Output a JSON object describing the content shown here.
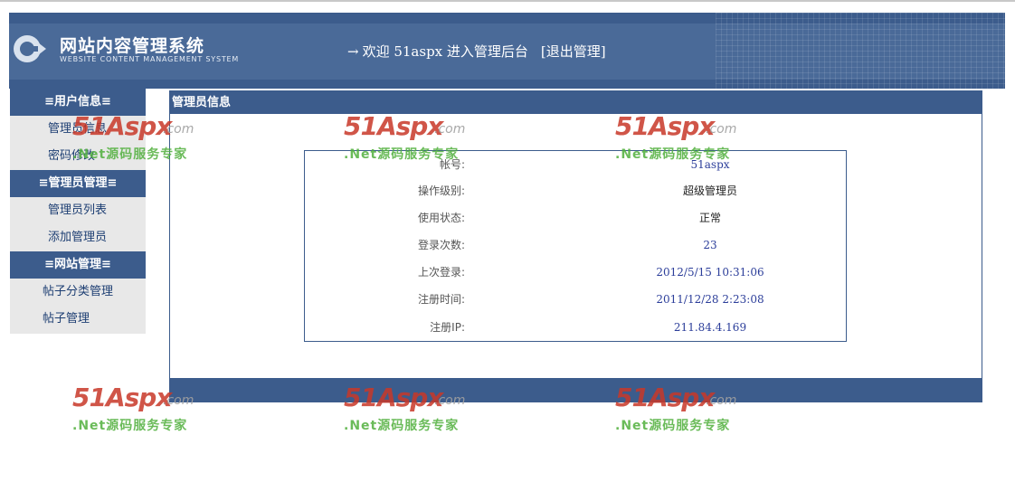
{
  "header": {
    "title": "网站内容管理系统",
    "subtitle": "WEBSITE CONTENT MANAGEMENT SYSTEM",
    "arrow": "→",
    "welcome": "欢迎 51aspx 进入管理后台",
    "logout": "[退出管理]"
  },
  "sidebar": {
    "sections": [
      {
        "heading": "≡用户信息≡",
        "items": [
          "管理员信息",
          "密码修改"
        ]
      },
      {
        "heading": "≡管理员管理≡",
        "items": [
          "管理员列表",
          "添加管理员"
        ]
      },
      {
        "heading": "≡网站管理≡",
        "items": [
          "帖子分类管理",
          "帖子管理"
        ]
      }
    ]
  },
  "panel": {
    "title": "管理员信息",
    "rows": [
      {
        "label": "帐号:",
        "value": "51aspx"
      },
      {
        "label": "操作级别:",
        "value": "超级管理员"
      },
      {
        "label": "使用状态:",
        "value": "正常"
      },
      {
        "label": "登录次数:",
        "value": "23"
      },
      {
        "label": "上次登录:",
        "value": "2012/5/15 10:31:06"
      },
      {
        "label": "注册时间:",
        "value": "2011/12/28 2:23:08"
      },
      {
        "label": "注册IP:",
        "value": "211.84.4.169"
      }
    ]
  },
  "watermark": {
    "brand": "51Aspx",
    "domain": ".com",
    "slogan": ".Net源码服务专家"
  },
  "colors": {
    "accent": "#3c5c8c",
    "value_text": "#2c3e9a",
    "sidebar_bg": "#e8e8e8"
  }
}
